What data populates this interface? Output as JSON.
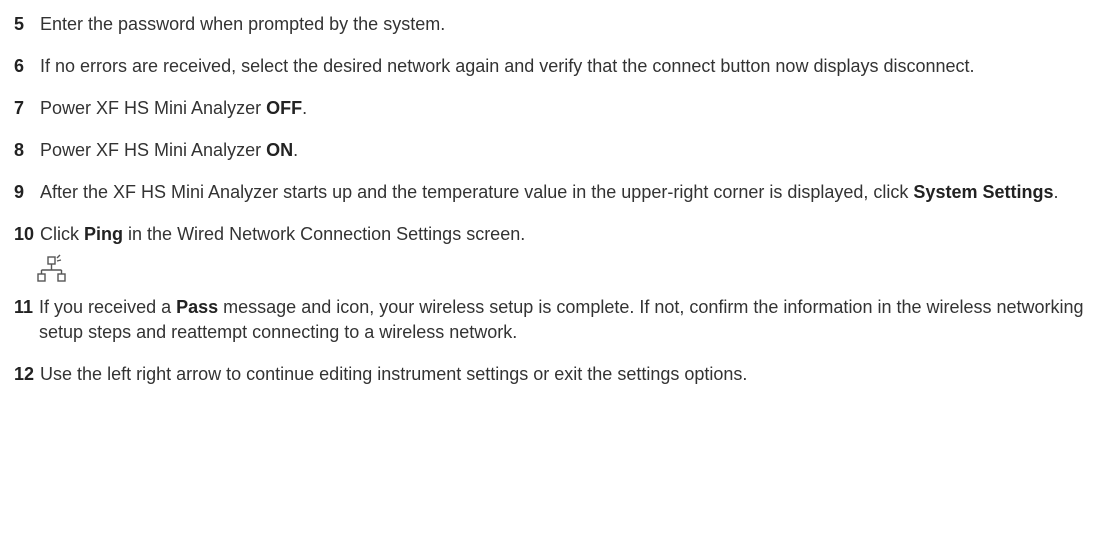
{
  "steps": [
    {
      "number": "5",
      "segments": [
        "Enter the password when prompted by the system."
      ]
    },
    {
      "number": "6",
      "segments": [
        "If no errors are received, select the desired network again and verify that the connect button now displays disconnect."
      ]
    },
    {
      "number": "7",
      "segments": [
        "Power XF HS Mini Analyzer ",
        "OFF",
        "."
      ]
    },
    {
      "number": "8",
      "segments": [
        "Power XF HS Mini Analyzer ",
        "ON",
        "."
      ]
    },
    {
      "number": "9",
      "segments": [
        "After the XF HS Mini Analyzer starts up and the temperature value in the upper-right corner is displayed, click ",
        "System Settings",
        "."
      ]
    },
    {
      "number": "10",
      "segments": [
        "Click ",
        "Ping",
        " in the Wired Network Connection Settings screen."
      ]
    },
    {
      "number": "11",
      "segments": [
        "If you received a ",
        "Pass",
        " message and icon, your wireless setup is complete. If not, confirm the information in the wireless networking setup steps and reattempt connecting to a wireless network."
      ]
    },
    {
      "number": "12",
      "segments": [
        "Use the left right arrow to continue editing instrument settings or exit the settings options."
      ]
    }
  ],
  "icons": {
    "network": "network-ping-icon"
  },
  "colors": {
    "text": "#333333",
    "icon": "#555555"
  }
}
